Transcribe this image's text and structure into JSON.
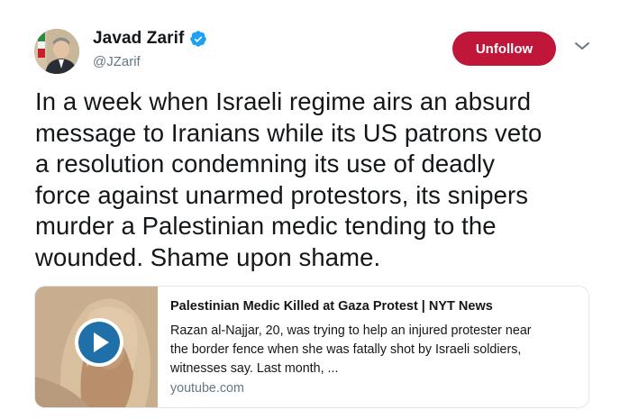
{
  "author": {
    "display_name": "Javad Zarif",
    "handle": "@JZarif",
    "verified": true
  },
  "actions": {
    "follow_button_label": "Unfollow",
    "menu_icon": "chevron-down-icon"
  },
  "tweet": {
    "text": "In a week when Israeli regime airs an absurd\nmessage to Iranians while its US patrons veto\na resolution condemning its use of deadly\nforce against unarmed protestors, its snipers\nmurder a Palestinian medic tending to the\nwounded. Shame upon shame."
  },
  "card": {
    "title": "Palestinian Medic Killed at Gaza Protest | NYT News",
    "description": "Razan al-Najjar, 20, was trying to help an injured protester near\nthe border fence when she was fatally shot by Israeli soldiers,\nwitnesses say. Last month, ...",
    "domain": "youtube.com",
    "thumbnail_icon": "play-icon"
  },
  "colors": {
    "unfollow_button": "#c0163a",
    "verified_badge": "#1da1f2",
    "play_button": "#1f6fa8",
    "secondary_text": "#657786",
    "card_border": "#e1e8ed"
  }
}
